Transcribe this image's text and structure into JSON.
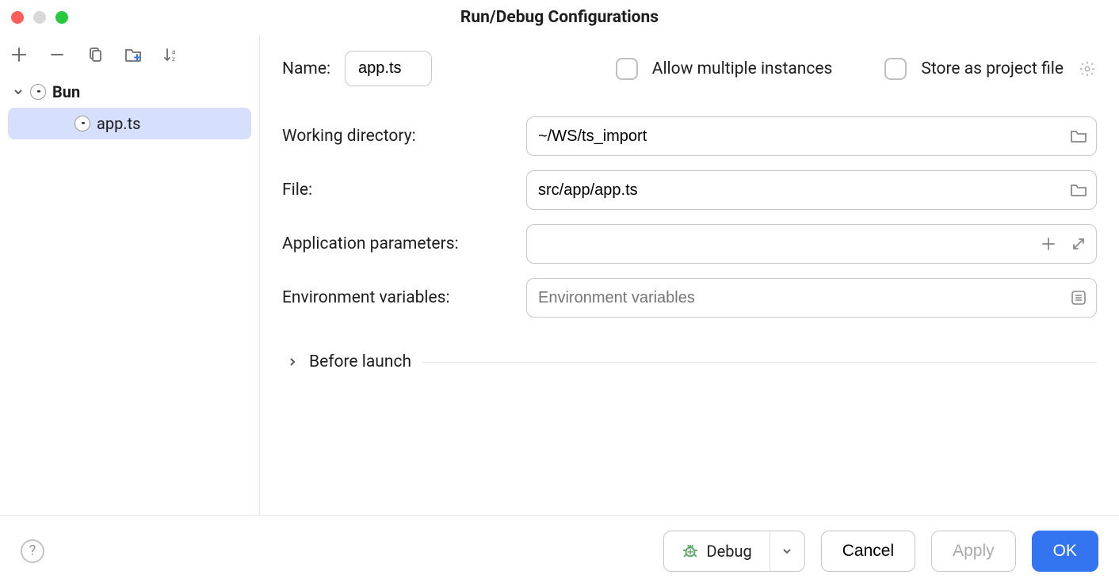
{
  "window": {
    "title": "Run/Debug Configurations"
  },
  "sidebar": {
    "group_label": "Bun",
    "items": [
      {
        "label": "app.ts",
        "selected": true
      }
    ]
  },
  "form": {
    "name": {
      "label": "Name:",
      "value": "app.ts"
    },
    "allow_multiple": {
      "label": "Allow multiple instances",
      "checked": false
    },
    "store_project_file": {
      "label": "Store as project file",
      "checked": false
    },
    "working_dir": {
      "label": "Working directory:",
      "value": "~/WS/ts_import"
    },
    "file": {
      "label": "File:",
      "value": "src/app/app.ts"
    },
    "app_params": {
      "label": "Application parameters:",
      "value": ""
    },
    "env_vars": {
      "label": "Environment variables:",
      "placeholder": "Environment variables",
      "value": ""
    },
    "before_launch": {
      "label": "Before launch"
    }
  },
  "footer": {
    "debug": "Debug",
    "cancel": "Cancel",
    "apply": "Apply",
    "ok": "OK"
  }
}
